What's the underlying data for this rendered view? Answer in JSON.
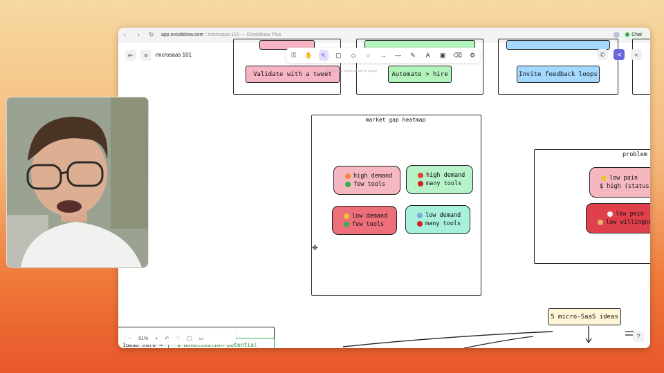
{
  "browser": {
    "url_host": "app.excalidraw.com",
    "url_path": " / microsaas 101 — Excalidraw Plus",
    "chat_label": "Chat"
  },
  "app": {
    "doc_title": "microsaas 101",
    "hint": "Scroll with mouse wheel or space"
  },
  "toolbar": {
    "tools": [
      "lock-icon",
      "hand-icon",
      "selection-icon",
      "rectangle-icon",
      "diamond-icon",
      "ellipse-icon",
      "arrow-icon",
      "line-icon",
      "pencil-icon",
      "text-icon",
      "image-icon",
      "eraser-icon",
      "extra-tools-icon"
    ],
    "active_tool_index": "1"
  },
  "canvas": {
    "top_boxes": [
      "Validate with a tweet",
      "Automate > hire",
      "Invite feedback loops"
    ],
    "heatmap": {
      "title": "market gap heatmap",
      "chips": [
        {
          "line1": "high demand",
          "line2": "few tools",
          "color": "#f5b8c0",
          "icon1": "#f08a3a",
          "icon2": "#2fb24a"
        },
        {
          "line1": "high demand",
          "line2": "many tools",
          "color": "#b8f2c8",
          "icon1": "#e0452e",
          "icon2": "#d92020"
        },
        {
          "line1": "low demand",
          "line2": "few tools",
          "color": "#ec6f7a",
          "icon1": "#f2c230",
          "icon2": "#2fb24a"
        },
        {
          "line1": "low demand",
          "line2": "many tools",
          "color": "#a6f0dc",
          "icon1": "#7fa9d9",
          "icon2": "#d92020"
        }
      ]
    },
    "problem": {
      "title": "problem",
      "chip1_line1": "low pain",
      "chip1_line2": "$ high (status)",
      "chip2_line1": "low pain",
      "chip2_line2": "low willingness"
    },
    "ideas_box": "5 micro-SaaS ideas",
    "bottom_left_label": "ideas here",
    "bottom_left_box": "$ monetisation potential"
  },
  "zoom": {
    "level": "91%",
    "minus": "−",
    "plus": "+"
  },
  "colors": {
    "accent": "#6965db",
    "pink_box": "#f7b5c4",
    "green_box": "#b2f2bb",
    "blue_box": "#a5d8ff"
  }
}
